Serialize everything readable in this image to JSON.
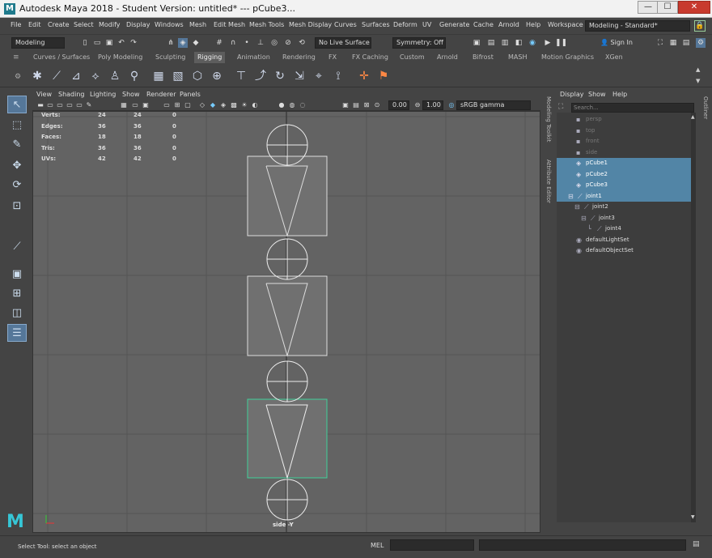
{
  "window": {
    "title": "Autodesk Maya 2018 - Student Version: untitled*   ---   pCube3...",
    "logo_letter": "M",
    "minimize": "—",
    "maximize": "☐",
    "close": "✕"
  },
  "menubar": [
    "File",
    "Edit",
    "Create",
    "Select",
    "Modify",
    "Display",
    "Windows",
    "Mesh",
    "Edit Mesh",
    "Mesh Tools",
    "Mesh Display",
    "Curves",
    "Surfaces",
    "Deform",
    "UV",
    "Generate",
    "Cache",
    "Arnold",
    "Help"
  ],
  "workspace": {
    "label": "Workspace :",
    "value": "Modeling - Standard*"
  },
  "statusline": {
    "mode": "Modeling",
    "live_surface": "No Live Surface",
    "symmetry": "Symmetry: Off",
    "sign_in": "Sign In"
  },
  "shelf_tabs": [
    "Curves / Surfaces",
    "Poly Modeling",
    "Sculpting",
    "Rigging",
    "Animation",
    "Rendering",
    "FX",
    "FX Caching",
    "Custom",
    "Arnold",
    "Bifrost",
    "MASH",
    "Motion Graphics",
    "XGen"
  ],
  "active_shelf_tab": "Rigging",
  "viewport": {
    "menus": [
      "View",
      "Shading",
      "Lighting",
      "Show",
      "Renderer",
      "Panels"
    ],
    "exposure": "0.00",
    "gamma": "1.00",
    "color_space": "sRGB gamma",
    "view_label": "side -Y",
    "hud": [
      {
        "label": "Verts:",
        "a": "24",
        "b": "24",
        "c": "0"
      },
      {
        "label": "Edges:",
        "a": "36",
        "b": "36",
        "c": "0"
      },
      {
        "label": "Faces:",
        "a": "18",
        "b": "18",
        "c": "0"
      },
      {
        "label": "Tris:",
        "a": "36",
        "b": "36",
        "c": "0"
      },
      {
        "label": "UVs:",
        "a": "42",
        "b": "42",
        "c": "0"
      }
    ]
  },
  "side_tabs": {
    "modeling_toolkit": "Modeling Toolkit",
    "attribute_editor": "Attribute Editor",
    "outliner": "Outliner"
  },
  "outliner": {
    "menus": [
      "Display",
      "Show",
      "Help"
    ],
    "search_placeholder": "Search...",
    "items": [
      {
        "name": "persp",
        "state": "dim"
      },
      {
        "name": "top",
        "state": "dim"
      },
      {
        "name": "front",
        "state": "dim"
      },
      {
        "name": "side",
        "state": "dim"
      },
      {
        "name": "pCube1",
        "state": "sel"
      },
      {
        "name": "pCube2",
        "state": "sel"
      },
      {
        "name": "pCube3",
        "state": "sel"
      },
      {
        "name": "joint1",
        "state": "sel"
      },
      {
        "name": "joint2",
        "state": "normal"
      },
      {
        "name": "joint3",
        "state": "normal"
      },
      {
        "name": "joint4",
        "state": "normal"
      },
      {
        "name": "defaultLightSet",
        "state": "normal"
      },
      {
        "name": "defaultObjectSet",
        "state": "normal"
      }
    ]
  },
  "bottom": {
    "help_line": "Select Tool: select an object",
    "mel_label": "MEL"
  },
  "colors": {
    "accent": "#5285a6",
    "viewport_bg": "#636363",
    "highlight_cube": "#3fd19a"
  }
}
